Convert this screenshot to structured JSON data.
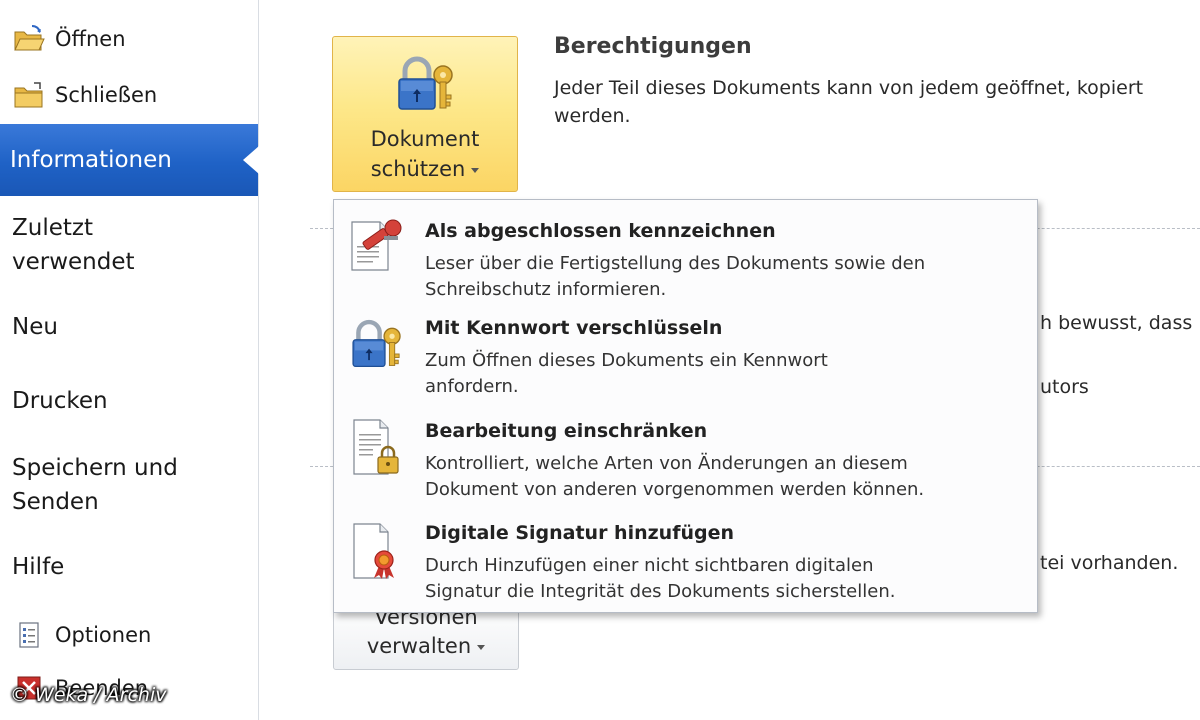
{
  "sidebar": {
    "open": "Öffnen",
    "close": "Schließen",
    "active": "Informationen",
    "recent_line1": "Zuletzt",
    "recent_line2": "verwendet",
    "new": "Neu",
    "print": "Drucken",
    "save_send_line1": "Speichern und",
    "save_send_line2": "Senden",
    "help": "Hilfe",
    "options": "Optionen",
    "exit": "Beenden"
  },
  "protect_button": {
    "line1": "Dokument",
    "line2": "schützen"
  },
  "permissions": {
    "title": "Berechtigungen",
    "description": "Jeder Teil dieses Dokuments kann von jedem geöffnet, kopiert werden."
  },
  "background_fragments": {
    "f1": "h bewusst, dass",
    "f2": "utors",
    "f3": "tei vorhanden."
  },
  "versions_button": {
    "line1": "Versionen",
    "line2": "verwalten"
  },
  "menu": {
    "items": [
      {
        "title": "Als abgeschlossen kennzeichnen",
        "desc1": "Leser über die Fertigstellung des Dokuments sowie den",
        "desc2": "Schreibschutz informieren.",
        "icon": "mark-final-icon"
      },
      {
        "title": "Mit Kennwort verschlüsseln",
        "desc1": "Zum Öffnen dieses Dokuments ein Kennwort",
        "desc2": "anfordern.",
        "icon": "lock-key-icon"
      },
      {
        "title": "Bearbeitung einschränken",
        "desc1": "Kontrolliert, welche Arten von Änderungen an diesem",
        "desc2": "Dokument von anderen vorgenommen werden können.",
        "icon": "restrict-editing-icon"
      },
      {
        "title": "Digitale Signatur hinzufügen",
        "desc1": "Durch Hinzufügen einer nicht sichtbaren digitalen",
        "desc2": "Signatur die Integrität des Dokuments sicherstellen.",
        "icon": "digital-signature-icon"
      }
    ]
  },
  "watermark": "© Weka / Archiv",
  "colors": {
    "accent_blue": "#1f62c6",
    "button_yellow": "#fde88a",
    "button_border": "#e1b449"
  }
}
